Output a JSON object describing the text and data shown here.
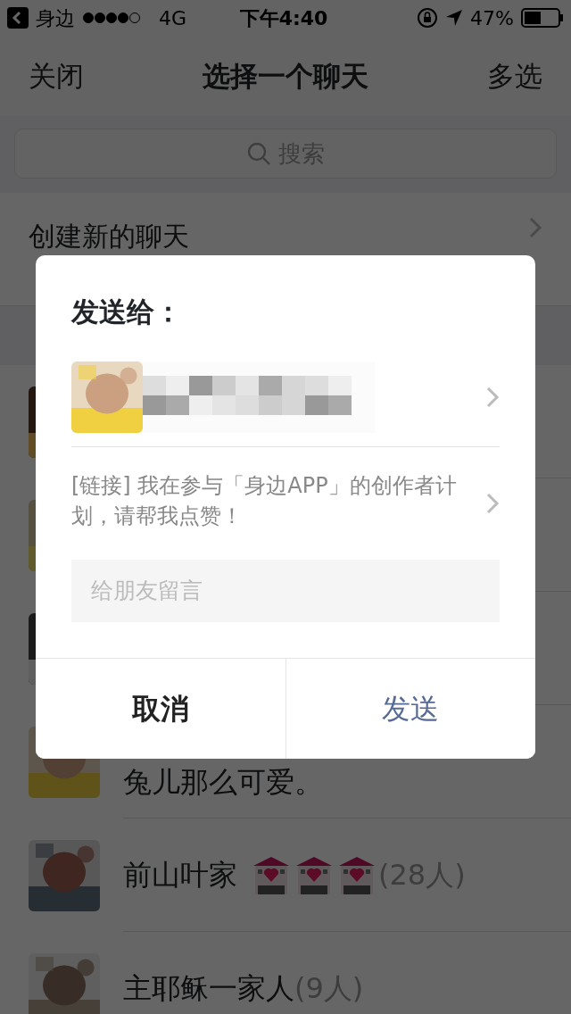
{
  "status_bar": {
    "back_app": "身边",
    "network": "4G",
    "time": "下午4:40",
    "battery": "47%"
  },
  "nav": {
    "left": "关闭",
    "title": "选择一个聊天",
    "right": "多选"
  },
  "search": {
    "placeholder": "搜索"
  },
  "create_chat": "创建新的聊天",
  "chats": [
    {
      "avatar": {
        "kind": "picture"
      }
    },
    {
      "avatar": {
        "kind": "picture"
      }
    },
    {
      "avatar": {
        "kind": "picture"
      }
    },
    {
      "avatar": {
        "kind": "picture"
      },
      "name": "兔儿那么可爱。"
    },
    {
      "avatar": {
        "kind": "picture"
      },
      "name": "前山叶家",
      "icons": [
        {
          "kind": "hotel"
        },
        {
          "kind": "hotel"
        },
        {
          "kind": "hotel"
        }
      ],
      "members": "(28人)"
    },
    {
      "avatar": {
        "kind": "picture"
      },
      "name": "主耶稣一家人",
      "members": "(9人)"
    }
  ],
  "dialog": {
    "title": "发送给：",
    "recipient": {
      "avatar": {
        "kind": "picture"
      },
      "name": {
        "kind": "picture"
      }
    },
    "message": "[链接] 我在参与「身边APP」的创作者计划，请帮我点赞！",
    "comment": {
      "placeholder": "给朋友留言"
    },
    "buttons": [
      {
        "label": "取消",
        "kind": "cancel"
      },
      {
        "label": "发送",
        "kind": "primary"
      }
    ]
  }
}
